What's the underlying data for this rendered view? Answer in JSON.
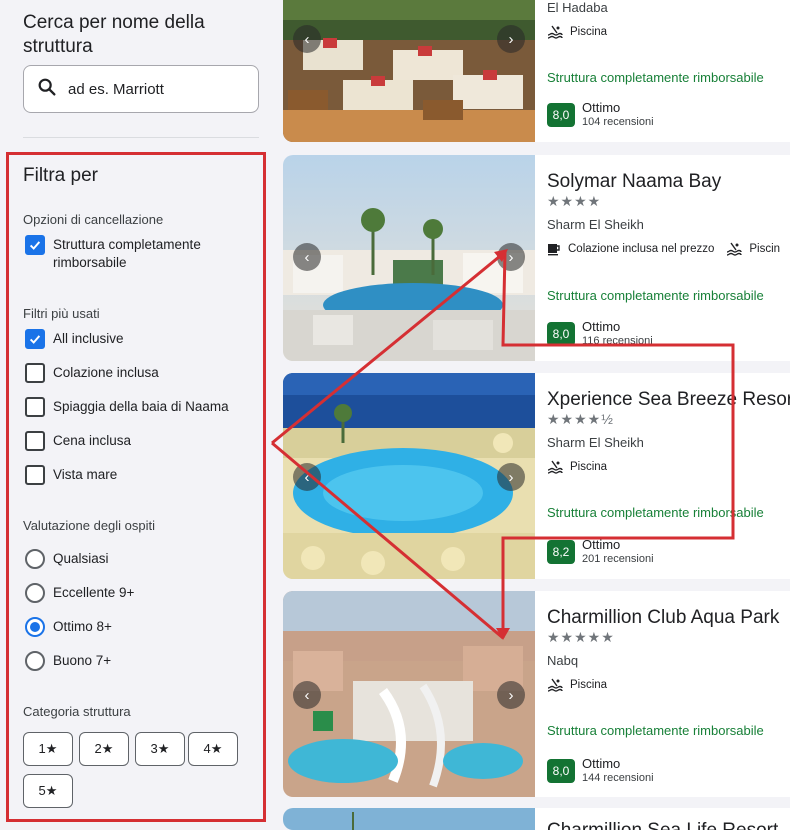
{
  "search": {
    "title": "Cerca per nome della struttura",
    "placeholder": "ad es. Marriott"
  },
  "filters": {
    "title": "Filtra per",
    "cancellation": {
      "label": "Opzioni di cancellazione",
      "options": [
        {
          "label": "Struttura completamente rimborsabile",
          "checked": true
        }
      ]
    },
    "popular": {
      "label": "Filtri più usati",
      "options": [
        {
          "label": "All inclusive",
          "checked": true
        },
        {
          "label": "Colazione inclusa",
          "checked": false
        },
        {
          "label": "Spiaggia della baia di Naama",
          "checked": false
        },
        {
          "label": "Cena inclusa",
          "checked": false
        },
        {
          "label": "Vista mare",
          "checked": false
        }
      ]
    },
    "guest_rating": {
      "label": "Valutazione degli ospiti",
      "options": [
        {
          "label": "Qualsiasi",
          "checked": false
        },
        {
          "label": "Eccellente 9+",
          "checked": false
        },
        {
          "label": "Ottimo 8+",
          "checked": true
        },
        {
          "label": "Buono 7+",
          "checked": false
        }
      ]
    },
    "category": {
      "label": "Categoria struttura",
      "buttons": [
        "1★",
        "2★",
        "3★",
        "4★",
        "5★"
      ]
    }
  },
  "results": [
    {
      "name": "",
      "stars": "",
      "location": "El Hadaba",
      "amenities": [
        "Piscina"
      ],
      "refund": "Struttura completamente rimborsabile",
      "score": "8,0",
      "rating_word": "Ottimo",
      "reviews": "104 recensioni"
    },
    {
      "name": "Solymar Naama Bay",
      "stars": "★★★★",
      "location": "Sharm El Sheikh",
      "amenities": [
        "Colazione inclusa nel prezzo",
        "Piscin"
      ],
      "refund": "Struttura completamente rimborsabile",
      "score": "8,0",
      "rating_word": "Ottimo",
      "reviews": "116 recensioni"
    },
    {
      "name": "Xperience Sea Breeze Resor",
      "stars": "★★★★½",
      "location": "Sharm El Sheikh",
      "amenities": [
        "Piscina"
      ],
      "refund": "Struttura completamente rimborsabile",
      "score": "8,2",
      "rating_word": "Ottimo",
      "reviews": "201 recensioni"
    },
    {
      "name": "Charmillion Club Aqua Park",
      "stars": "★★★★★",
      "location": "Nabq",
      "amenities": [
        "Piscina"
      ],
      "refund": "Struttura completamente rimborsabile",
      "score": "8,0",
      "rating_word": "Ottimo",
      "reviews": "144 recensioni"
    },
    {
      "name": "Charmillion Sea Life Resort",
      "stars": "",
      "location": "",
      "amenities": [],
      "refund": "",
      "score": "",
      "rating_word": "",
      "reviews": ""
    }
  ],
  "colors": {
    "highlight": "#d52f33",
    "checkbox": "#1a73e8",
    "score_bg": "#137333",
    "refund_text": "#188038"
  },
  "icons": [
    "search-icon",
    "check-icon",
    "chevron-left-icon",
    "chevron-right-icon",
    "coffee-icon",
    "pool-icon",
    "star-icon"
  ]
}
